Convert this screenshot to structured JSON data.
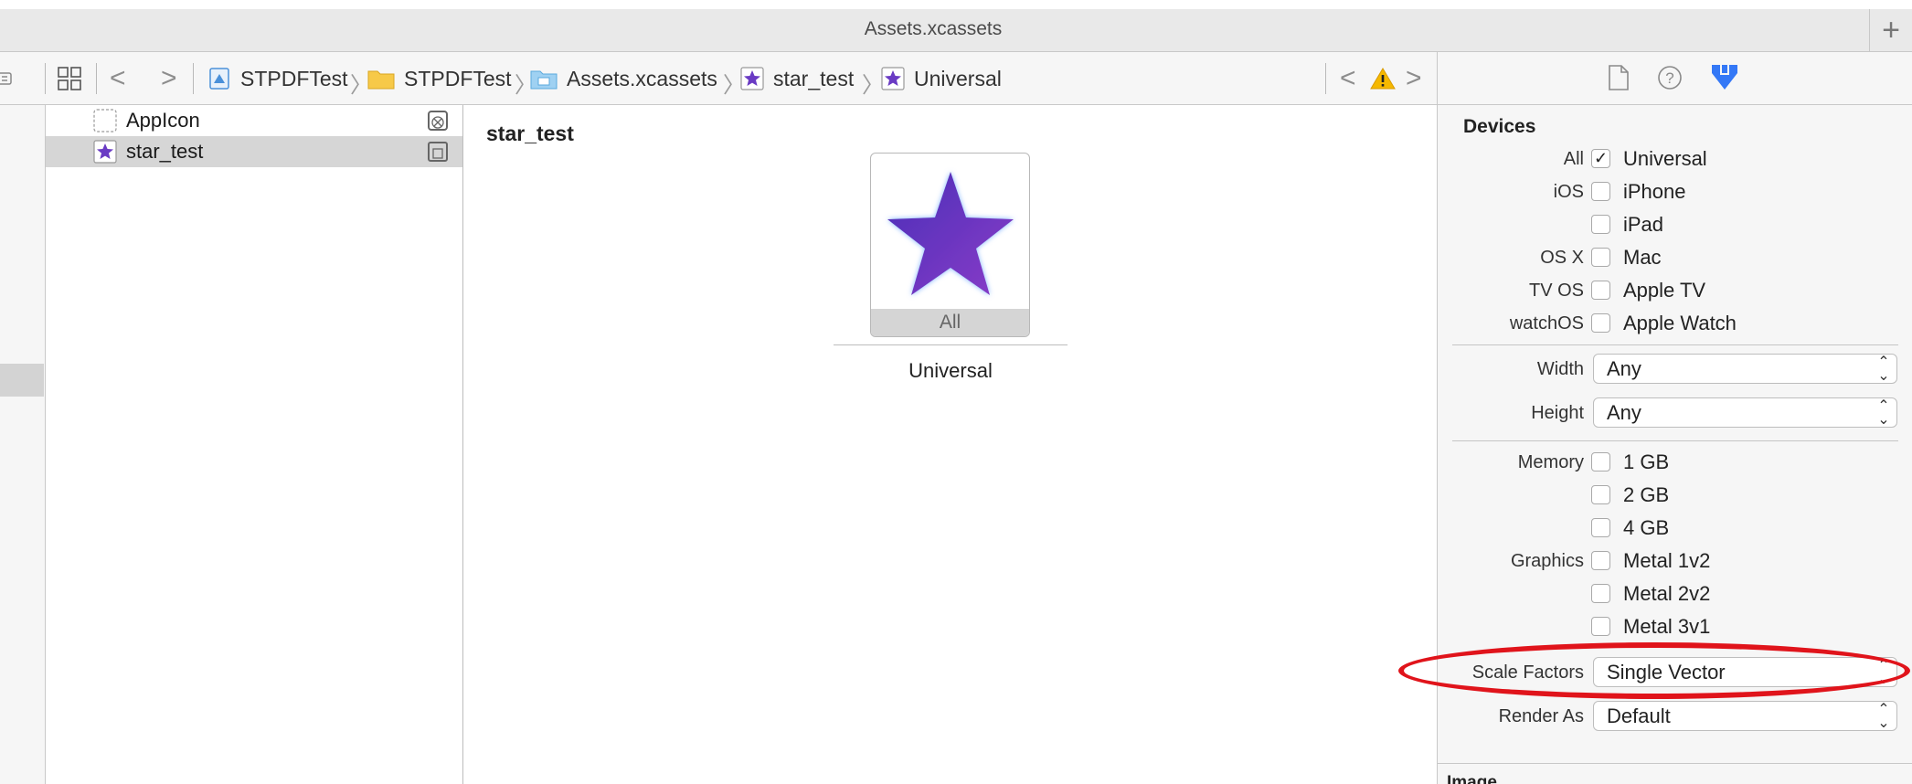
{
  "window": {
    "tab_title": "Assets.xcassets",
    "add_tab_label": "+"
  },
  "jumpbar": {
    "back": "<",
    "forward": ">",
    "crumbs": [
      "STPDFTest",
      "STPDFTest",
      "Assets.xcassets",
      "star_test",
      "Universal"
    ],
    "issue_prev": "<",
    "issue_next": ">"
  },
  "asset_list": {
    "items": [
      {
        "name": "AppIcon"
      },
      {
        "name": "star_test"
      }
    ]
  },
  "canvas": {
    "set_title": "star_test",
    "slot_label": "All",
    "slot_caption": "Universal",
    "star_color": "#6a3bc4"
  },
  "inspector": {
    "devices_title": "Devices",
    "devices": [
      {
        "group": "All",
        "label": "Universal",
        "checked": "✓"
      },
      {
        "group": "iOS",
        "label": "iPhone",
        "checked": ""
      },
      {
        "group": "",
        "label": "iPad",
        "checked": ""
      },
      {
        "group": "OS X",
        "label": "Mac",
        "checked": ""
      },
      {
        "group": "TV OS",
        "label": "Apple TV",
        "checked": ""
      },
      {
        "group": "watchOS",
        "label": "Apple Watch",
        "checked": ""
      }
    ],
    "width": {
      "label": "Width",
      "value": "Any"
    },
    "height": {
      "label": "Height",
      "value": "Any"
    },
    "memory": {
      "label": "Memory",
      "options": [
        "1 GB",
        "2 GB",
        "4 GB"
      ]
    },
    "graphics": {
      "label": "Graphics",
      "options": [
        "Metal 1v2",
        "Metal 2v2",
        "Metal 3v1"
      ]
    },
    "scale_factors": {
      "label": "Scale Factors",
      "value": "Single Vector"
    },
    "render_as": {
      "label": "Render As",
      "value": "Default"
    },
    "next_section": "Image"
  },
  "annotation_color": "#e0141b"
}
